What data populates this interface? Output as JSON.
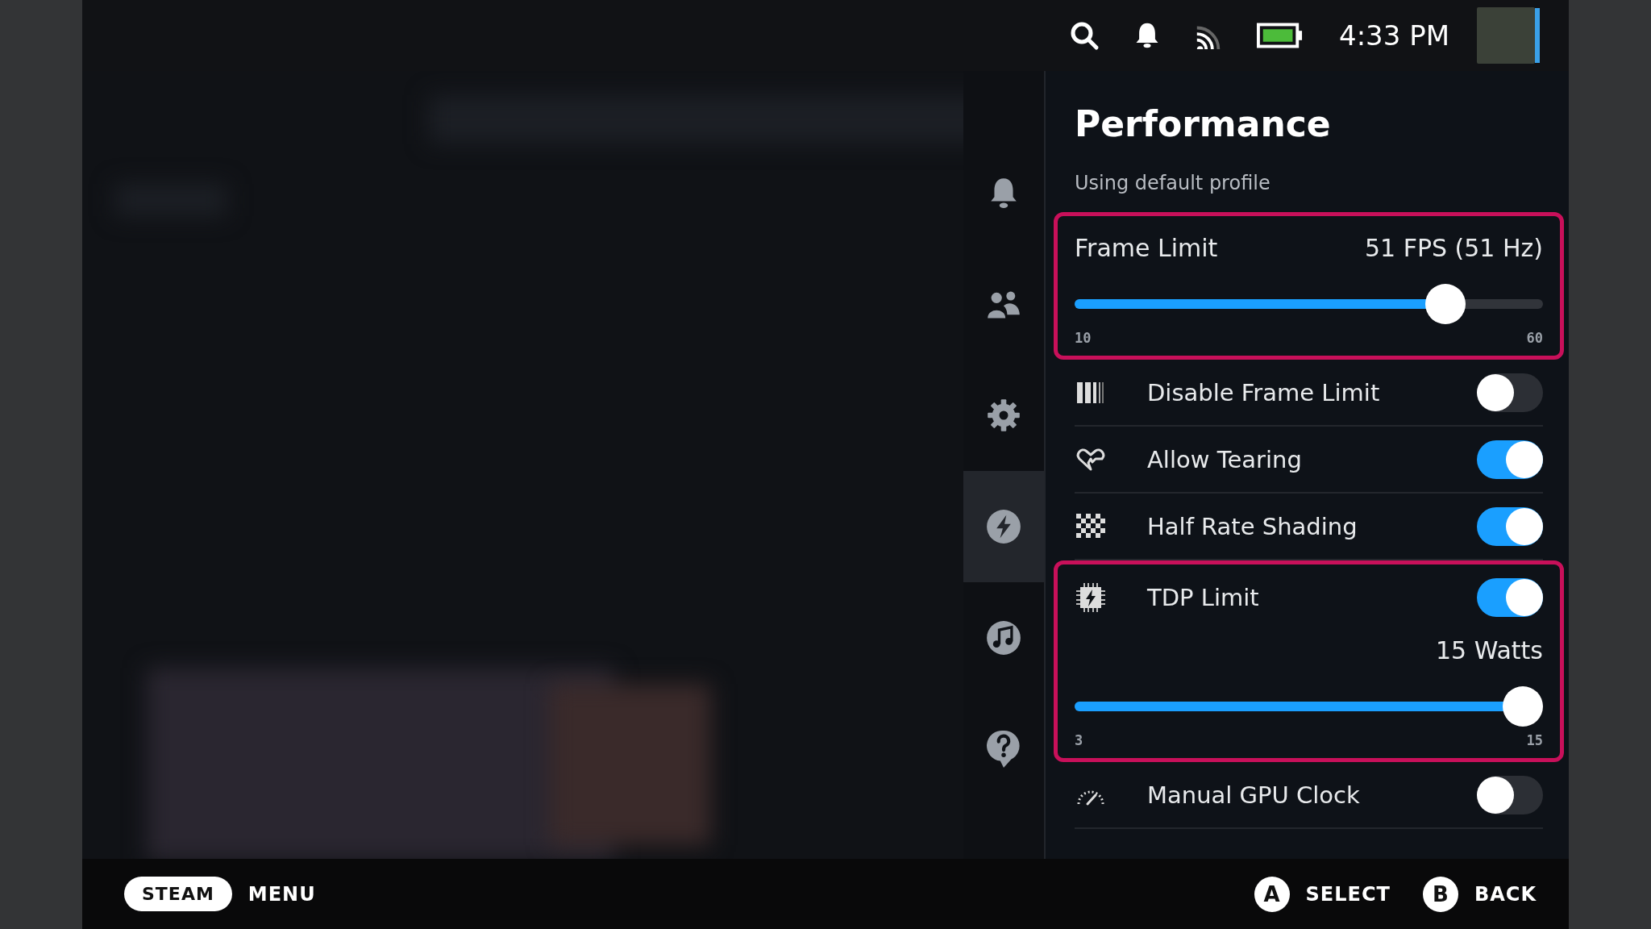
{
  "top_bar": {
    "time": "4:33 PM"
  },
  "sidebar": {
    "items": [
      {
        "kind": "notifications",
        "selected": false
      },
      {
        "kind": "friends",
        "selected": false
      },
      {
        "kind": "settings",
        "selected": false
      },
      {
        "kind": "performance",
        "selected": true
      },
      {
        "kind": "music",
        "selected": false
      },
      {
        "kind": "help",
        "selected": false
      }
    ]
  },
  "panel": {
    "title": "Performance",
    "subtitle": "Using default profile",
    "items": [
      {
        "kind": "slider",
        "label": "Frame Limit",
        "reading": "51 FPS (51 Hz)",
        "level": 0.82,
        "min": "10",
        "max": "60",
        "highlighted": true
      },
      {
        "kind": "toggle",
        "label": "Disable Frame Limit",
        "on": false,
        "highlighted": false
      },
      {
        "kind": "toggle",
        "label": "Allow Tearing",
        "on": true,
        "highlighted": false
      },
      {
        "kind": "toggle",
        "label": "Half Rate Shading",
        "on": true,
        "highlighted": false
      },
      {
        "kind": "toggle_slider",
        "label": "TDP Limit",
        "on": true,
        "reading": "15 Watts",
        "level": 1,
        "min": "3",
        "max": "15",
        "highlighted": true
      },
      {
        "kind": "toggle",
        "label": "Manual GPU Clock",
        "on": false,
        "highlighted": false
      }
    ]
  },
  "bottom_bar": {
    "steam": "STEAM",
    "menu": "MENU",
    "hints": [
      {
        "key": "A",
        "label": "SELECT"
      },
      {
        "key": "B",
        "label": "BACK"
      }
    ]
  }
}
